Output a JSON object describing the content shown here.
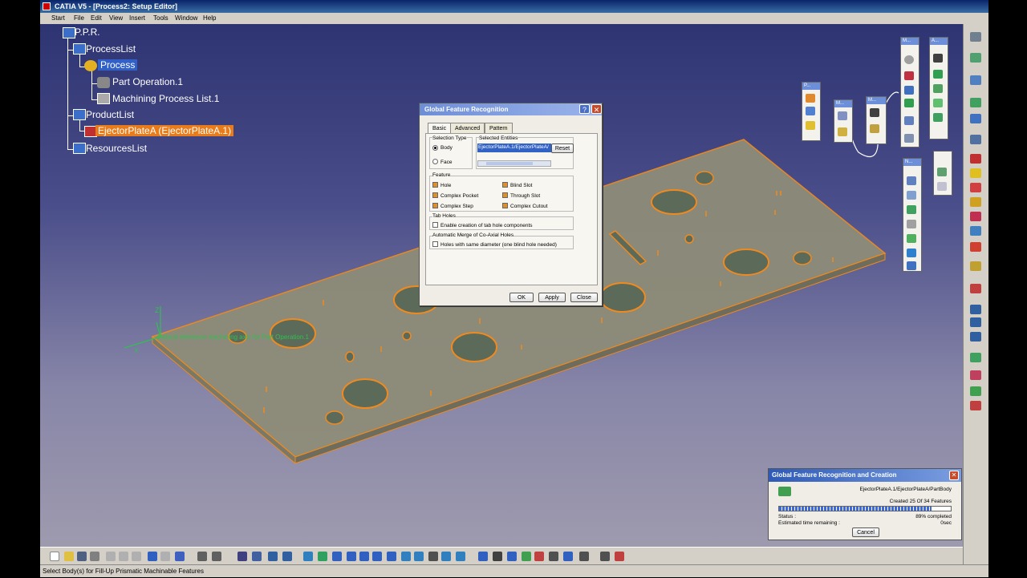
{
  "window": {
    "title": "CATIA V5 - [Process2: Setup Editor]"
  },
  "menu": [
    "Start",
    "File",
    "Edit",
    "View",
    "Insert",
    "Tools",
    "Window",
    "Help"
  ],
  "tree": {
    "root": "P.P.R.",
    "process_list": "ProcessList",
    "process": "Process",
    "part_operation": "Part Operation.1",
    "machining_list": "Machining Process List.1",
    "product_list": "ProductList",
    "ejector": "EjectorPlateA (EjectorPlateA.1)",
    "resources": "ResourcesList"
  },
  "viewport": {
    "axis_label": "Default reference machining axis for Part Operation.1"
  },
  "gfr_dialog": {
    "title": "Global Feature Recognition",
    "tabs": [
      "Basic",
      "Advanced",
      "Pattern"
    ],
    "selection_type_label": "Selection Type",
    "selected_entities_label": "Selected Entities",
    "body_label": "Body",
    "face_label": "Face",
    "selected_entity": "EjectorPlateA.1/EjectorPlateA/",
    "reset_label": "Reset",
    "feature_label": "Feature",
    "features": [
      "Hole",
      "Blind Slot",
      "Complex Pocket",
      "Through Slot",
      "Complex Step",
      "Complex Cutout"
    ],
    "tab_holes_label": "Tab Holes",
    "tab_holes_option": "Enable creation of tab hole components",
    "merge_label": "Automatic Merge of Co-Axial Holes",
    "merge_option": "Holes with same diameter (one blind hole needed)",
    "ok_label": "OK",
    "apply_label": "Apply",
    "close_label": "Close"
  },
  "progress_dialog": {
    "title": "Global Feature Recognition and Creation",
    "path": "EjectorPlateA.1/EjectorPlateA/PartBody",
    "created": "Created 25 Of 34 Features",
    "status_label": "Status :",
    "status_value": "89% completed",
    "remaining_label": "Estimated time remaining :",
    "remaining_value": "0sec",
    "cancel_label": "Cancel",
    "progress": 0.89
  },
  "statusbar": {
    "text": "Select Body(s) for Fill-Up Prismatic Machinable Features"
  },
  "mini_toolbars": [
    "P...",
    "M...",
    "M...",
    "M...",
    "A...",
    "N..."
  ],
  "colors": {
    "background_top": "#2e3472",
    "background_bottom": "#9e9aae",
    "plate": "#8e8c78",
    "edge": "#f08a1e",
    "selection": "#3060c8",
    "highlight": "#e87b1a"
  }
}
